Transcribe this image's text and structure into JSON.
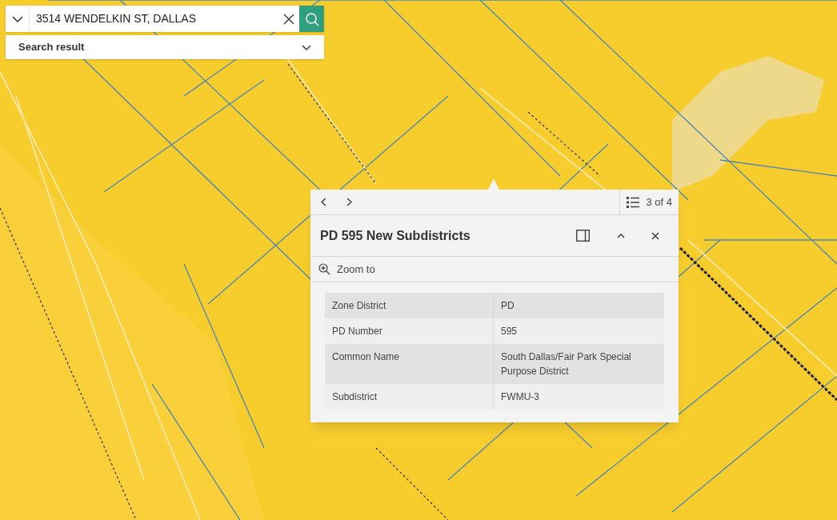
{
  "search": {
    "value": "3514 WENDELKIN ST, DALLAS",
    "results_label": "Search result"
  },
  "popup": {
    "pager": "3 of 4",
    "title": "PD 595 New Subdistricts",
    "zoom_action": "Zoom to",
    "fields": [
      {
        "label": "Zone District",
        "value": "PD"
      },
      {
        "label": "PD Number",
        "value": "595"
      },
      {
        "label": "Common Name",
        "value": "South Dallas/Fair Park Special Purpose District"
      },
      {
        "label": "Subdistrict",
        "value": "FWMU-3"
      }
    ]
  }
}
